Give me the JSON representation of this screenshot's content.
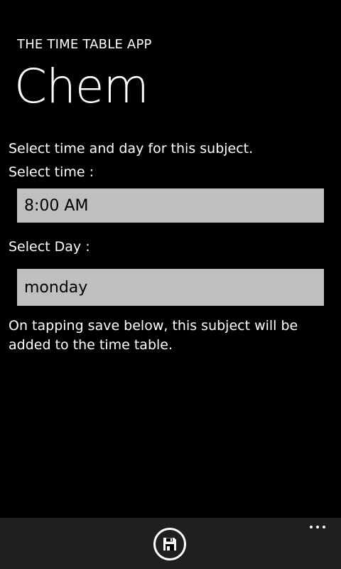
{
  "app": {
    "title": "THE TIME TABLE APP",
    "page_title": "Chem"
  },
  "form": {
    "instruction": "Select time and day for this subject.",
    "time_label": "Select time :",
    "time_value": "8:00 AM",
    "day_label": "Select Day :",
    "day_value": "monday",
    "note": "On tapping save below, this subject will be added to the time table."
  },
  "app_bar": {
    "buttons": [
      {
        "icon": "save-icon"
      }
    ],
    "menu_icon": "more-options-icon"
  },
  "colors": {
    "background": "#000000",
    "field_background": "#bfbfbf",
    "app_bar_background": "#1f1f1f",
    "text": "#ffffff"
  }
}
